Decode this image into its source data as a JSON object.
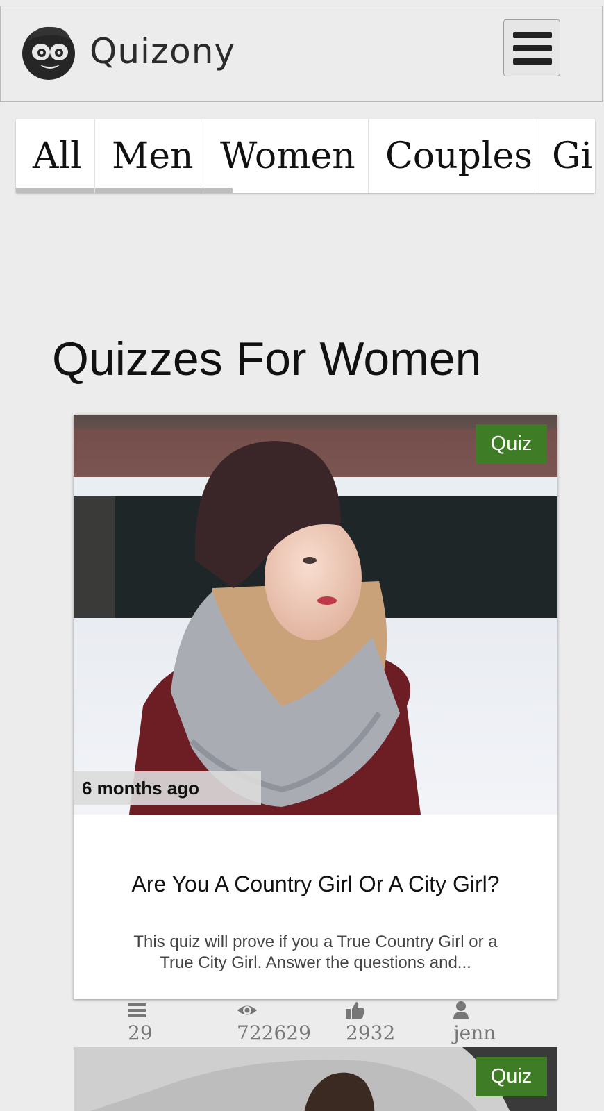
{
  "header": {
    "logo_text": "Quizony",
    "menu_icon": "hamburger-menu-icon"
  },
  "tabs": [
    {
      "label": "All"
    },
    {
      "label": "Men"
    },
    {
      "label": "Women"
    },
    {
      "label": "Couples"
    },
    {
      "label": "Gi"
    }
  ],
  "main": {
    "title": "Quizzes For Women"
  },
  "cards": [
    {
      "badge": "Quiz",
      "time": "6 months ago",
      "title": "Are You A Country Girl Or A City Girl?",
      "description": "This quiz will prove if you a True Country Girl or a True City Girl. Answer the questions and...",
      "stats": {
        "questions": "29",
        "views": "722629",
        "likes": "2932",
        "author": "jenn"
      }
    },
    {
      "badge": "Quiz"
    }
  ],
  "icons": {
    "questions": "list-icon",
    "views": "eye-icon",
    "likes": "thumbs-up-icon",
    "author": "user-icon"
  },
  "colors": {
    "badge_green": "#3e7c26",
    "background": "#ececec"
  }
}
